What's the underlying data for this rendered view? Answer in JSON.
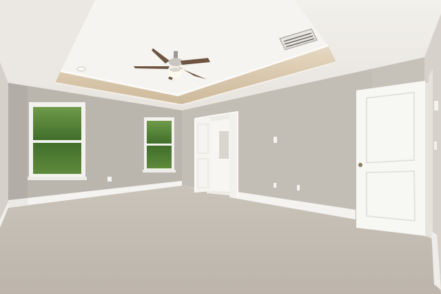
{
  "scene": {
    "subject": "empty-bedroom",
    "palette": {
      "ceiling": "#f4f2ee",
      "wall_left": "#bcb8b0",
      "wall_back": "#c4bfb6",
      "wall_right": "#d2cec7",
      "tray_band": "#d9c9b0",
      "carpet": "#c8c1b7",
      "trim": "#f6f5f2",
      "door": "#f7f7f4",
      "foliage": "#4f7a33"
    }
  }
}
